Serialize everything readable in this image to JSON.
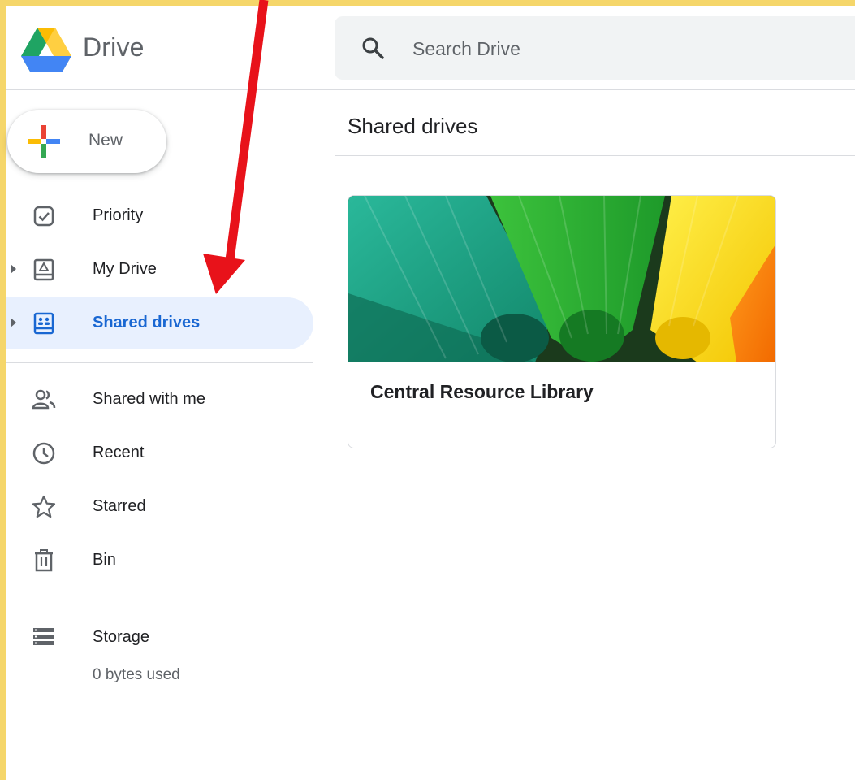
{
  "app": {
    "title": "Drive"
  },
  "search": {
    "placeholder": "Search Drive",
    "value": ""
  },
  "sidebar": {
    "new_label": "New",
    "items": [
      {
        "label": "Priority",
        "icon": "priority-icon",
        "active": false
      },
      {
        "label": "My Drive",
        "icon": "my-drive-icon",
        "active": false
      },
      {
        "label": "Shared drives",
        "icon": "shared-drives-icon",
        "active": true
      },
      {
        "label": "Shared with me",
        "icon": "people-icon",
        "active": false
      },
      {
        "label": "Recent",
        "icon": "clock-icon",
        "active": false
      },
      {
        "label": "Starred",
        "icon": "star-icon",
        "active": false
      },
      {
        "label": "Bin",
        "icon": "trash-icon",
        "active": false
      },
      {
        "label": "Storage",
        "icon": "storage-icon",
        "active": false
      }
    ],
    "storage_used": "0 bytes used"
  },
  "main": {
    "title": "Shared drives",
    "drives": [
      {
        "name": "Central Resource Library"
      }
    ]
  },
  "colors": {
    "accent": "#1967d2",
    "active_bg": "#e8f0fe",
    "frame": "#f5d66a",
    "annotation_arrow": "#e8121a"
  }
}
